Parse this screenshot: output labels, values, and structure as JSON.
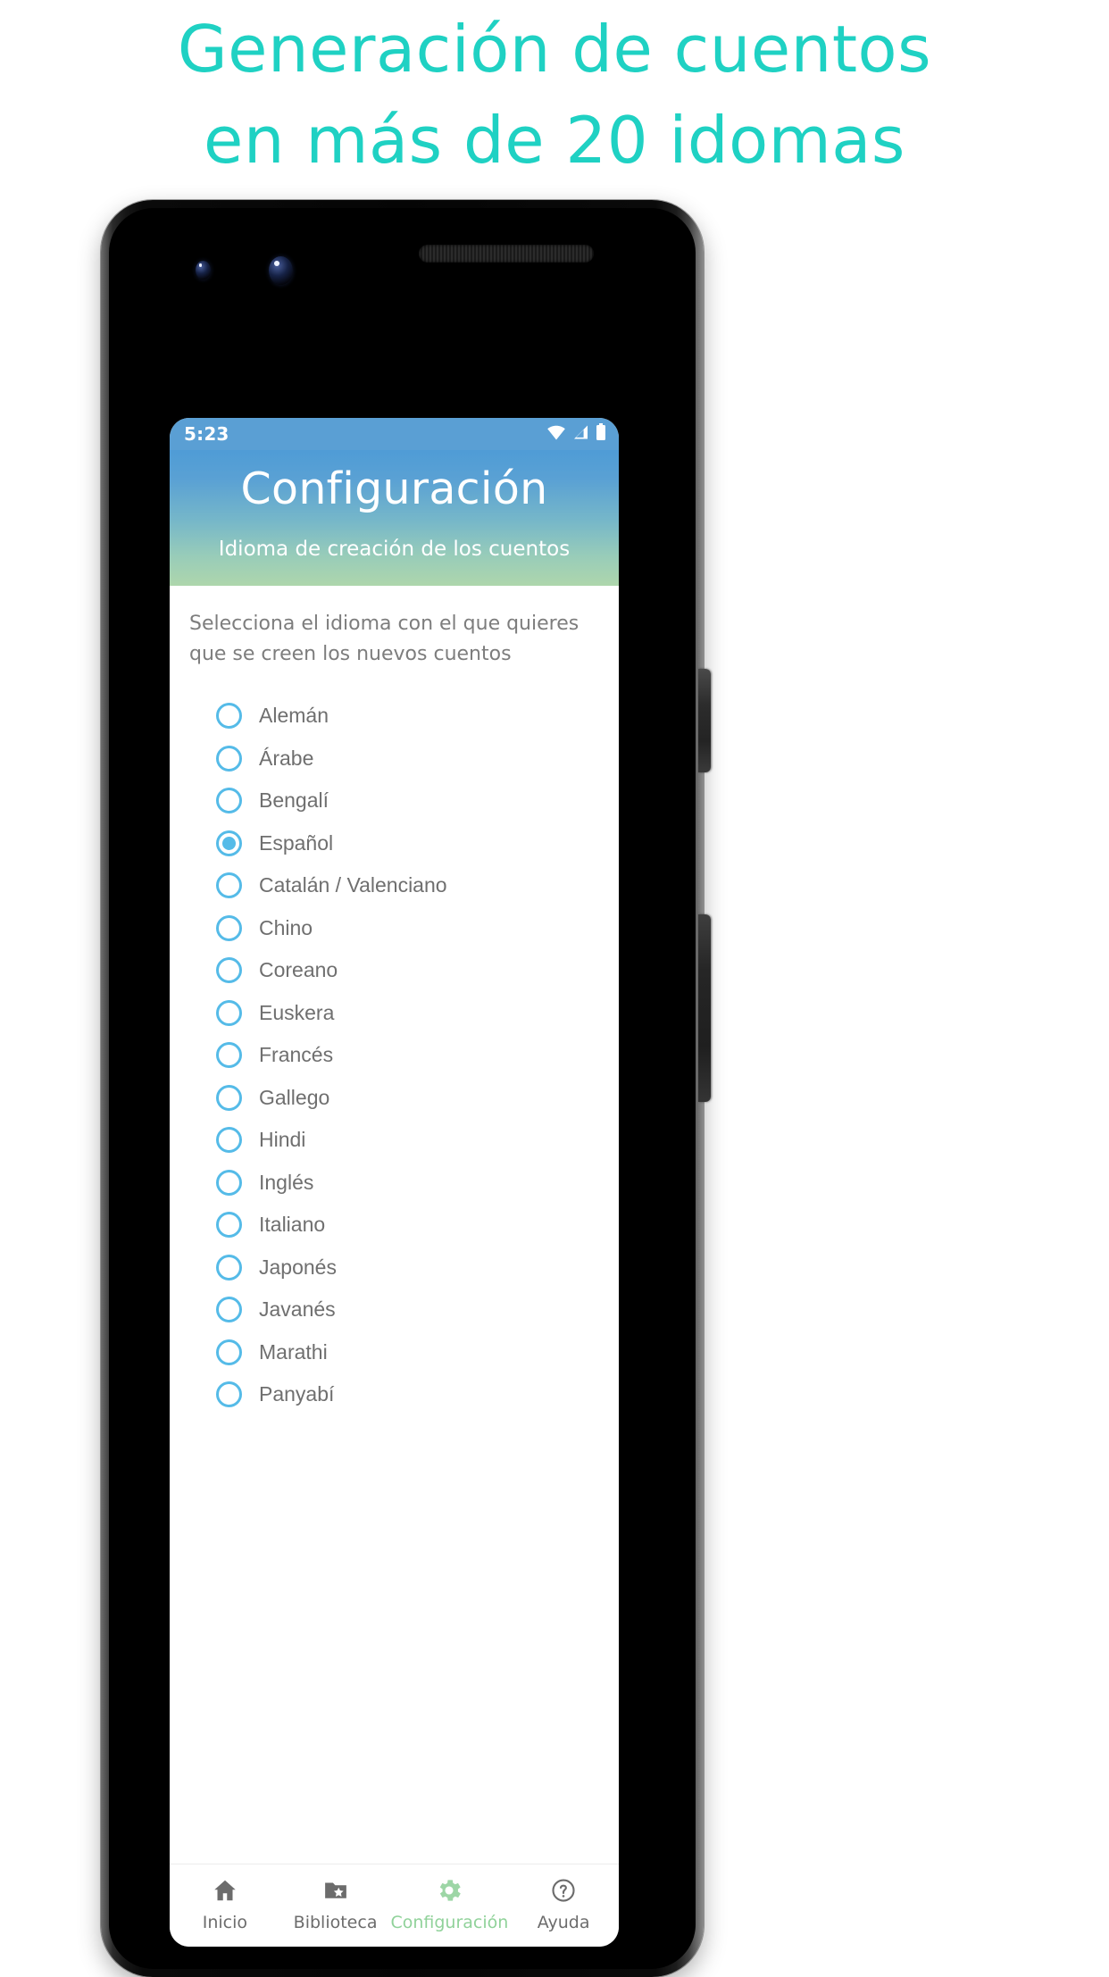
{
  "promo": {
    "line1": "Generación de cuentos",
    "line2": "en más de 20 idomas",
    "color": "#1fd1c3"
  },
  "phone": {
    "statusbar": {
      "time": "5:23",
      "background": "#5a9fd4",
      "icons": [
        "wifi-icon",
        "signal-icon",
        "battery-icon"
      ]
    },
    "header": {
      "title": "Configuración",
      "subtitle": "Idioma de creación de los cuentos",
      "gradient_from": "#4f9cd6",
      "gradient_to": "#aed6ac"
    },
    "content": {
      "description": "Selecciona el idioma con el que quieres que se creen los nuevos cuentos",
      "radio_color": "#55bbe8",
      "selected": "Español",
      "languages": [
        {
          "label": "Alemán",
          "checked": false
        },
        {
          "label": "Árabe",
          "checked": false
        },
        {
          "label": "Bengalí",
          "checked": false
        },
        {
          "label": "Español",
          "checked": true
        },
        {
          "label": "Catalán / Valenciano",
          "checked": false
        },
        {
          "label": "Chino",
          "checked": false
        },
        {
          "label": "Coreano",
          "checked": false
        },
        {
          "label": "Euskera",
          "checked": false
        },
        {
          "label": "Francés",
          "checked": false
        },
        {
          "label": "Gallego",
          "checked": false
        },
        {
          "label": "Hindi",
          "checked": false
        },
        {
          "label": "Inglés",
          "checked": false
        },
        {
          "label": "Italiano",
          "checked": false
        },
        {
          "label": "Japonés",
          "checked": false
        },
        {
          "label": "Javanés",
          "checked": false
        },
        {
          "label": "Marathi",
          "checked": false
        },
        {
          "label": "Panyabí",
          "checked": false
        }
      ]
    },
    "bottom_nav": {
      "active_color": "#90d29a",
      "inactive_color": "#6c6c6c",
      "items": [
        {
          "label": "Inicio",
          "icon": "home-icon",
          "active": false
        },
        {
          "label": "Biblioteca",
          "icon": "folder-star-icon",
          "active": false
        },
        {
          "label": "Configuración",
          "icon": "gear-icon",
          "active": true
        },
        {
          "label": "Ayuda",
          "icon": "help-circle-icon",
          "active": false
        }
      ]
    }
  }
}
